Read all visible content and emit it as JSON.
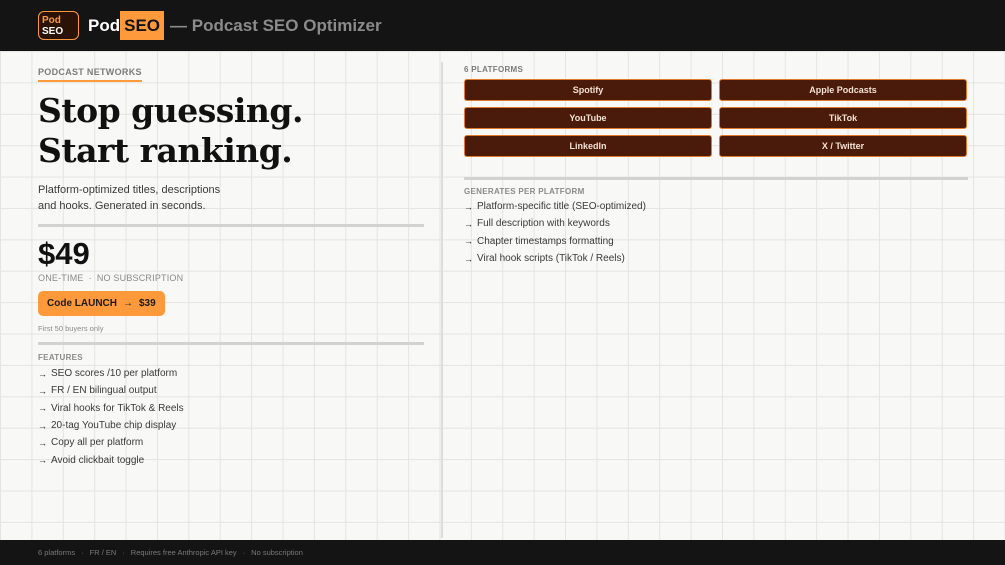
{
  "header": {
    "logo_line1": "Pod",
    "logo_line2": "SEO",
    "brand_pod": "Pod",
    "brand_seo": "SEO",
    "tagline": "— Podcast SEO Optimizer"
  },
  "hero": {
    "eyebrow": "PODCAST NETWORKS",
    "headline_line1": "Stop guessing.",
    "headline_line2": "Start ranking.",
    "subtitle_line1": "Platform-optimized titles, descriptions",
    "subtitle_line2": "and hooks. Generated in seconds."
  },
  "pricing": {
    "price": "$49",
    "note_one_time": "ONE-TIME",
    "note_separator": "·",
    "note_no_sub": "NO SUBSCRIPTION",
    "cta_code": "Code LAUNCH",
    "cta_arrow": "→",
    "cta_price": "$39",
    "small_note": "First 50 buyers only"
  },
  "features": {
    "label": "FEATURES",
    "arrow": "→",
    "items": [
      "SEO scores /10 per platform",
      "FR / EN bilingual output",
      "Viral hooks for TikTok & Reels",
      "20-tag YouTube chip display",
      "Copy all per platform",
      "Avoid clickbait toggle"
    ]
  },
  "platforms": {
    "label": "6 PLATFORMS",
    "items": [
      "Spotify",
      "Apple Podcasts",
      "YouTube",
      "TikTok",
      "LinkedIn",
      "X / Twitter"
    ]
  },
  "generates": {
    "label": "GENERATES PER PLATFORM",
    "arrow": "→",
    "items": [
      "Platform-specific title (SEO-optimized)",
      "Full description with keywords",
      "Chapter timestamps formatting",
      "Viral hook scripts (TikTok / Reels)"
    ]
  },
  "footer": {
    "separator": "·",
    "items": [
      "6 platforms",
      "FR / EN",
      "Requires free Anthropic API key",
      "No subscription"
    ]
  },
  "colors": {
    "accent": "#ff9a3c",
    "dark": "#141414",
    "platform_bg": "#4a1a0a",
    "platform_border": "#e07b2c"
  }
}
